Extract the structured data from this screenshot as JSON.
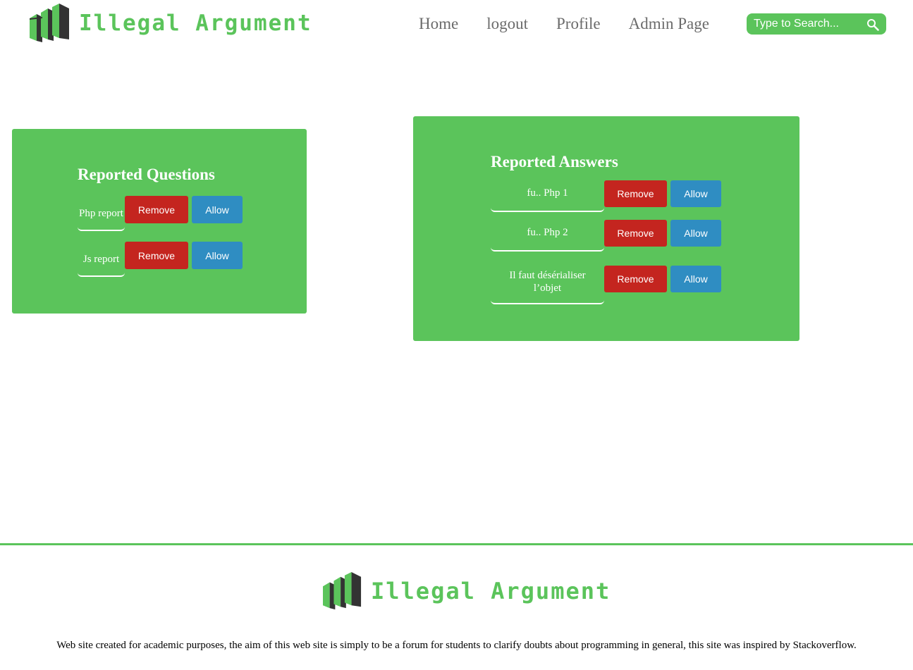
{
  "brand": {
    "name": "Illegal Argument",
    "color": "#5bc45b",
    "icon": "stacked-blocks-logo-icon"
  },
  "nav": {
    "home": "Home",
    "logout": "logout",
    "profile": "Profile",
    "admin": "Admin Page"
  },
  "search": {
    "placeholder": "Type to Search...",
    "icon": "search-icon"
  },
  "questions": {
    "title": "Reported Questions",
    "items": [
      {
        "label": "Php report",
        "remove": "Remove",
        "allow": "Allow"
      },
      {
        "label": "Js report",
        "remove": "Remove",
        "allow": "Allow"
      }
    ]
  },
  "answers": {
    "title": "Reported Answers",
    "items": [
      {
        "label": "fu.. Php 1",
        "remove": "Remove",
        "allow": "Allow"
      },
      {
        "label": "fu.. Php 2",
        "remove": "Remove",
        "allow": "Allow"
      },
      {
        "label": "Il faut désérialiser l’objet",
        "remove": "Remove",
        "allow": "Allow"
      }
    ]
  },
  "colors": {
    "panel": "#5bc45b",
    "remove": "#c4251f",
    "allow": "#2f8dc2"
  },
  "footer": {
    "text": "Web site created for academic purposes, the aim of this web site is simply to be a forum for students to clarify doubts about programming in general, this site was inspired by Stackoverflow."
  }
}
